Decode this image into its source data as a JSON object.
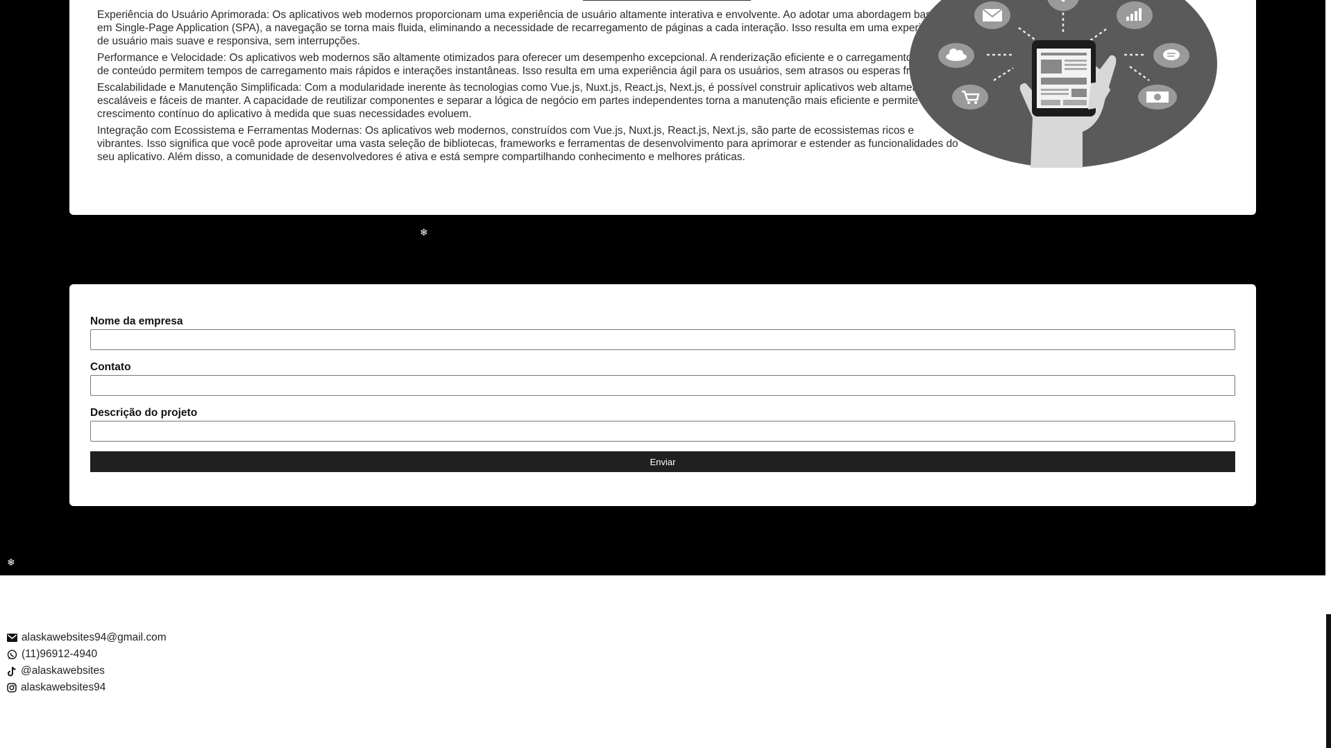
{
  "content": {
    "paragraphs": [
      "Experiência do Usuário Aprimorada: Os aplicativos web modernos proporcionam uma experiência de usuário altamente interativa e envolvente. Ao adotar uma abordagem baseada em Single-Page Application (SPA), a navegação se torna mais fluida, eliminando a necessidade de recarregamento de páginas a cada interação. Isso resulta em uma experiência de usuário mais suave e responsiva, sem interrupções.",
      "Performance e Velocidade: Os aplicativos web modernos são altamente otimizados para oferecer um desempenho excepcional. A renderização eficiente e o carregamento dinâmico de conteúdo permitem tempos de carregamento mais rápidos e interações instantâneas. Isso resulta em uma experiência ágil para os usuários, sem atrasos ou esperas frustrantes.",
      "Escalabilidade e Manutenção Simplificada: Com a modularidade inerente às tecnologias como Vue.js, Nuxt.js, React.js, Next.js, é possível construir aplicativos web altamente escaláveis e fáceis de manter. A capacidade de reutilizar componentes e separar a lógica de negócio em partes independentes torna a manutenção mais eficiente e permite o crescimento contínuo do aplicativo à medida que suas necessidades evoluem.",
      "Integração com Ecossistema e Ferramentas Modernas: Os aplicativos web modernos, construídos com Vue.js, Nuxt.js, React.js, Next.js, são parte de ecossistemas ricos e vibrantes. Isso significa que você pode aproveitar uma vasta seleção de bibliotecas, frameworks e ferramentas de desenvolvimento para aprimorar e estender as funcionalidades do seu aplicativo. Além disso, a comunidade de desenvolvedores é ativa e está sempre compartilhando conhecimento e melhores práticas."
    ],
    "illustration_icons": [
      "mail-icon",
      "wifi-icon",
      "bar-chart-icon",
      "cloud-icon",
      "chat-icon",
      "cart-icon",
      "money-icon",
      "smartphone-icon"
    ]
  },
  "decor": {
    "snowflake": "❄"
  },
  "form": {
    "company_label": "Nome da empresa",
    "contact_label": "Contato",
    "description_label": "Descrição do projeto",
    "company_value": "",
    "contact_value": "",
    "description_value": "",
    "submit_label": "Enviar"
  },
  "footer": {
    "email": "alaskawebsites94@gmail.com",
    "phone": "(11)96912-4940",
    "tiktok": "@alaskawebsites",
    "instagram": "alaskawebsites94",
    "icons": [
      "envelope-icon",
      "whatsapp-icon",
      "tiktok-icon",
      "instagram-icon"
    ]
  },
  "colors": {
    "background_dark": "#000000",
    "card": "#ffffff",
    "button": "#202020",
    "illustration_disc": "#5a5a5a"
  }
}
